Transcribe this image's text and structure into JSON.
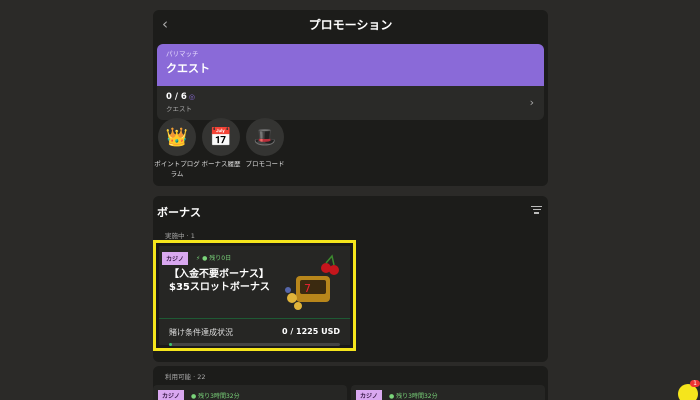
{
  "header": {
    "title": "プロモーション",
    "back_icon": "chevron-left-icon"
  },
  "quest": {
    "label_small": "パリマッチ",
    "label": "クエスト",
    "progress": "0 / 6",
    "sub": "クエスト"
  },
  "shortcuts": [
    {
      "icon": "crown-icon",
      "label": "ポイントプログラム"
    },
    {
      "icon": "calendar-icon",
      "label": "ボーナス履歴"
    },
    {
      "icon": "magic-hat-icon",
      "label": "プロモコード"
    }
  ],
  "bonus": {
    "title": "ボーナス",
    "active_count": "実施中 · 1",
    "card": {
      "badge": "カジノ",
      "time_left": "残り0日",
      "title_line1": "【入金不要ボーナス】",
      "title_line2": "$35スロットボーナス",
      "wager_label": "賭け条件達成状況",
      "wager_value": "0 / 1225 USD",
      "progress": 0.0
    },
    "available_count": "利用可能 · 22",
    "mini_cards": [
      {
        "badge": "カジノ",
        "time_left": "残り3時間32分"
      },
      {
        "badge": "カジノ",
        "time_left": "残り3時間32分"
      }
    ]
  },
  "colors": {
    "accent_purple": "#8a6ad8",
    "highlight_yellow": "#f5e51c",
    "success_green": "#3cc36a"
  },
  "notification": {
    "count": "1"
  }
}
